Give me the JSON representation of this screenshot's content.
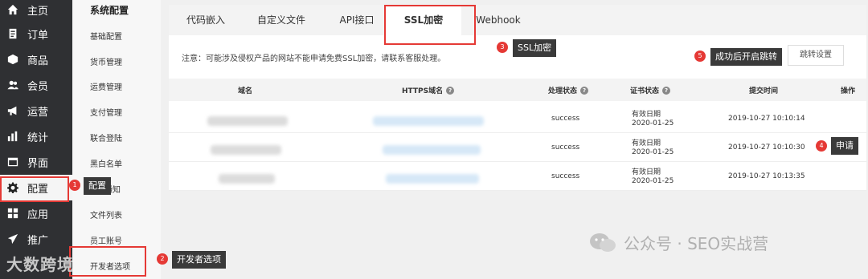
{
  "sidebar": {
    "items": [
      {
        "label": "主页",
        "icon": "home-icon"
      },
      {
        "label": "订单",
        "icon": "order-icon"
      },
      {
        "label": "商品",
        "icon": "box-icon"
      },
      {
        "label": "会员",
        "icon": "users-icon"
      },
      {
        "label": "运营",
        "icon": "megaphone-icon"
      },
      {
        "label": "统计",
        "icon": "chart-icon"
      },
      {
        "label": "界面",
        "icon": "window-icon"
      },
      {
        "label": "配置",
        "icon": "gear-icon",
        "active": true
      },
      {
        "label": "应用",
        "icon": "apps-icon"
      },
      {
        "label": "推广",
        "icon": "send-icon"
      }
    ]
  },
  "subnav": {
    "title": "系统配置",
    "items": [
      "基础配置",
      "货币管理",
      "运费管理",
      "支付管理",
      "联合登陆",
      "黑白名单",
      "通知",
      "文件列表",
      "员工账号",
      "开发者选项"
    ]
  },
  "tabs": [
    "代码嵌入",
    "自定义文件",
    "API接口",
    "SSL加密",
    "Webhook"
  ],
  "active_tab": "SSL加密",
  "notice": "注意：可能涉及侵权产品的网站不能申请免费SSL加密，请联系客服处理。",
  "jump_button": "跳转设置",
  "table": {
    "headers": [
      "域名",
      "HTTPS域名",
      "处理状态",
      "证书状态",
      "提交时间",
      "操作"
    ],
    "help_mark": "?",
    "rows": [
      {
        "status": "success",
        "cert_label": "有效日期",
        "cert_date": "2020-01-25",
        "time": "2019-10-27 10:10:14"
      },
      {
        "status": "success",
        "cert_label": "有效日期",
        "cert_date": "2020-01-25",
        "time": "2019-10-27 10:10:30"
      },
      {
        "status": "success",
        "cert_label": "有效日期",
        "cert_date": "2020-01-25",
        "time": "2019-10-27 10:13:35"
      }
    ]
  },
  "annotations": [
    {
      "num": "1",
      "text": "配置"
    },
    {
      "num": "2",
      "text": "开发者选项"
    },
    {
      "num": "3",
      "text": "SSL加密"
    },
    {
      "num": "4",
      "text": "申请"
    },
    {
      "num": "5",
      "text": "成功后开启跳转"
    }
  ],
  "watermark": "公众号 · SEO实战营",
  "logo_watermark": "大数跨境",
  "colors": {
    "sidebar_bg": "#2f3033",
    "annotation_red": "#e53935",
    "callout_bg": "#3a3a3a",
    "blur_blue": "#d6e8f7"
  }
}
